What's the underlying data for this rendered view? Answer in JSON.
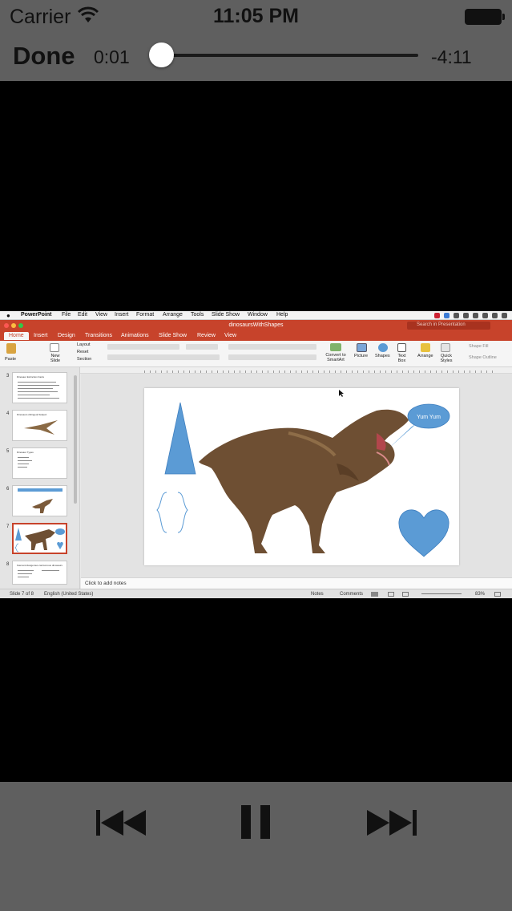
{
  "status_bar": {
    "carrier": "Carrier",
    "time": "11:05 PM",
    "wifi_icon": "wifi-icon",
    "battery_icon": "battery-icon"
  },
  "player": {
    "done_label": "Done",
    "elapsed": "0:01",
    "remaining": "-4:11",
    "progress": 0.004,
    "controls": {
      "previous_icon": "skip-back-icon",
      "pause_icon": "pause-icon",
      "next_icon": "skip-forward-icon"
    }
  },
  "ppt": {
    "menu": [
      "PowerPoint",
      "File",
      "Edit",
      "View",
      "Insert",
      "Format",
      "Arrange",
      "Tools",
      "Slide Show",
      "Window",
      "Help"
    ],
    "doc_title": "dinosaursWithShapes",
    "search_placeholder": "Search in Presentation",
    "tabs": [
      "Home",
      "Insert",
      "Design",
      "Transitions",
      "Animations",
      "Slide Show",
      "Review",
      "View"
    ],
    "ribbon": {
      "paste": "Paste",
      "new_slide": "New Slide",
      "layout": "Layout",
      "reset": "Reset",
      "section": "Section",
      "convert": "Convert to SmartArt",
      "picture": "Picture",
      "shapes": "Shapes",
      "text_box": "Text Box",
      "arrange": "Arrange",
      "quick_styles": "Quick Styles",
      "shape_fill": "Shape Fill",
      "shape_outline": "Shape Outline"
    },
    "thumbnails": [
      {
        "num": "3",
        "title": "Dinosaur Extinction Facts"
      },
      {
        "num": "4",
        "title": "Dinosaurs (Winged) Subject"
      },
      {
        "num": "5",
        "title": "Dinosaur Types"
      },
      {
        "num": "6",
        "title": ""
      },
      {
        "num": "7",
        "title": ""
      },
      {
        "num": "8",
        "title": "Fast and dangerous carnivorous dinosaurs"
      }
    ],
    "selected_slide": 7,
    "slide": {
      "speech_bubble": "Yum Yum"
    },
    "notes_placeholder": "Click to add notes",
    "status": {
      "slide_of": "Slide 7 of 8",
      "language": "English (United States)",
      "notes": "Notes",
      "comments": "Comments",
      "zoom": "83%"
    },
    "colors": {
      "accent": "#c7432b",
      "shape_blue": "#5b9bd5"
    }
  }
}
